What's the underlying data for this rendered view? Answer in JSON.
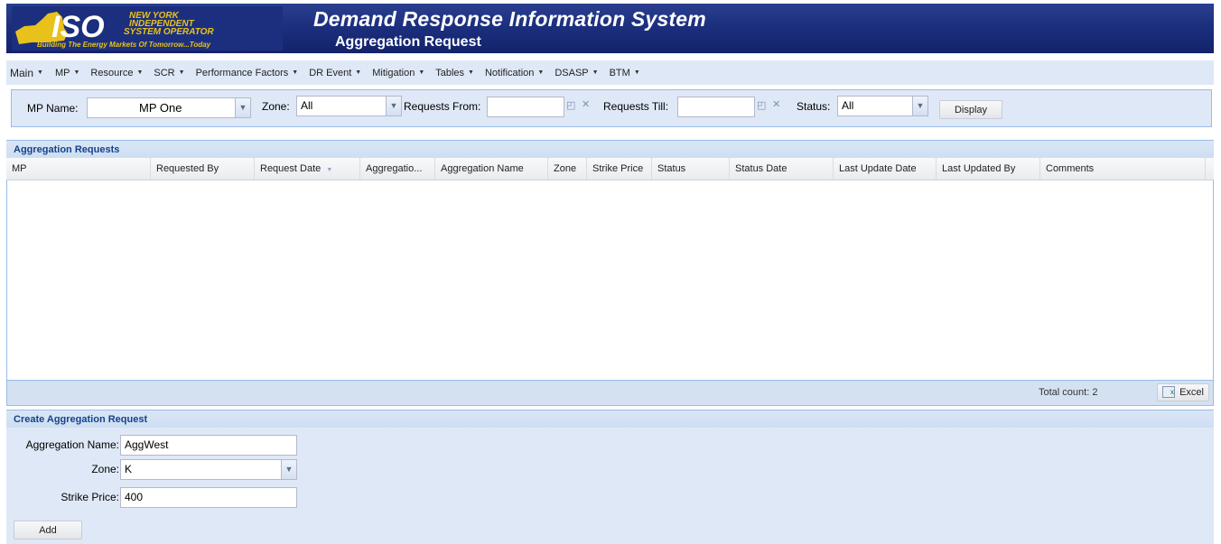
{
  "header": {
    "logo_text": "ISO",
    "logo_org_line1": "NEW YORK",
    "logo_org_line2": "INDEPENDENT",
    "logo_org_line3": "SYSTEM OPERATOR",
    "logo_tagline": "Building The Energy Markets Of Tomorrow...Today",
    "title": "Demand Response Information System",
    "subtitle": "Aggregation Request"
  },
  "menu": [
    {
      "label": "Main"
    },
    {
      "label": "MP"
    },
    {
      "label": "Resource"
    },
    {
      "label": "SCR"
    },
    {
      "label": "Performance Factors"
    },
    {
      "label": "DR Event"
    },
    {
      "label": "Mitigation"
    },
    {
      "label": "Tables"
    },
    {
      "label": "Notification"
    },
    {
      "label": "DSASP"
    },
    {
      "label": "BTM"
    }
  ],
  "filters": {
    "mp_name_label": "MP Name:",
    "mp_name_value": "MP One",
    "zone_label": "Zone:",
    "zone_value": "All",
    "requests_from_label": "Requests From:",
    "requests_from_value": "",
    "requests_till_label": "Requests Till:",
    "requests_till_value": "",
    "status_label": "Status:",
    "status_value": "All",
    "display_button": "Display"
  },
  "grid": {
    "title": "Aggregation Requests",
    "columns": [
      {
        "label": "MP"
      },
      {
        "label": "Requested By"
      },
      {
        "label": "Request Date",
        "sorted": true
      },
      {
        "label": "Aggregatio..."
      },
      {
        "label": "Aggregation Name"
      },
      {
        "label": "Zone"
      },
      {
        "label": "Strike Price"
      },
      {
        "label": "Status"
      },
      {
        "label": "Status Date"
      },
      {
        "label": "Last Update Date"
      },
      {
        "label": "Last Updated By"
      },
      {
        "label": "Comments"
      }
    ],
    "rows": [],
    "total_count": "Total count: 2",
    "excel_button": "Excel"
  },
  "create_form": {
    "title": "Create Aggregation Request",
    "aggregation_name_label": "Aggregation Name:",
    "aggregation_name_value": "AggWest",
    "zone_label": "Zone:",
    "zone_value": "K",
    "strike_price_label": "Strike Price:",
    "strike_price_value": "400",
    "add_button": "Add"
  },
  "colors": {
    "banner": "#1c2f7e",
    "panel_bg": "#dfe8f6",
    "panel_border": "#99bbe8",
    "panel_title": "#15428b",
    "logo_gold": "#e8c21a"
  }
}
